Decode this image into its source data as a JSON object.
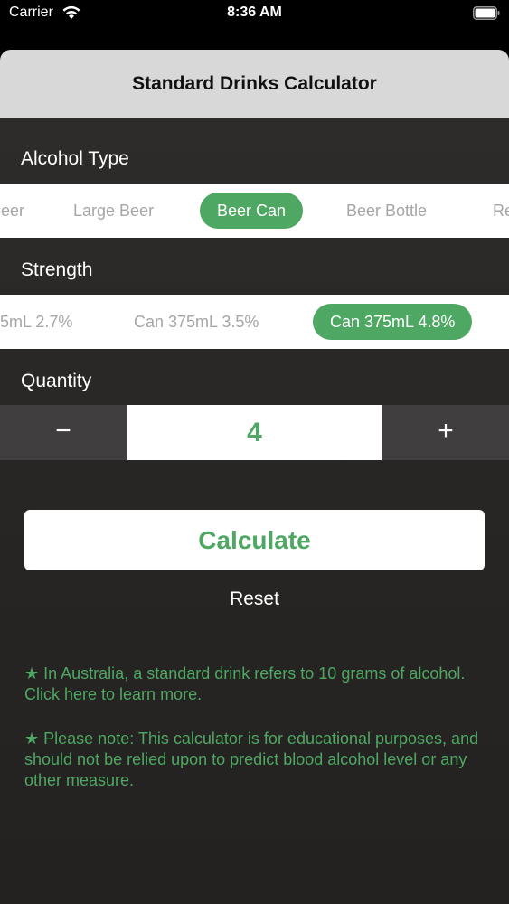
{
  "status_bar": {
    "carrier": "Carrier",
    "time": "8:36 AM"
  },
  "sheet": {
    "title": "Standard Drinks Calculator"
  },
  "alcohol_type": {
    "label": "Alcohol Type",
    "options": [
      "eer",
      "Large Beer",
      "Beer Can",
      "Beer Bottle",
      "Re"
    ],
    "selected": "Beer Can"
  },
  "strength": {
    "label": "Strength",
    "options": [
      "5mL 2.7%",
      "Can 375mL 3.5%",
      "Can 375mL 4.8%"
    ],
    "selected": "Can 375mL 4.8%"
  },
  "quantity": {
    "label": "Quantity",
    "minus": "−",
    "value": "4",
    "plus": "+"
  },
  "actions": {
    "calculate": "Calculate",
    "reset": "Reset"
  },
  "notes": {
    "note1": "★ In Australia, a standard drink refers to 10 grams of alcohol. Click here to learn more.",
    "note2": "★ Please note: This calculator is for educational purposes, and should not be relied upon to predict blood alcohol level or any other measure."
  },
  "colors": {
    "accent": "#4ea763",
    "header": "#d8d8d8",
    "background": "#2a2827",
    "stepper": "#403e3f"
  }
}
